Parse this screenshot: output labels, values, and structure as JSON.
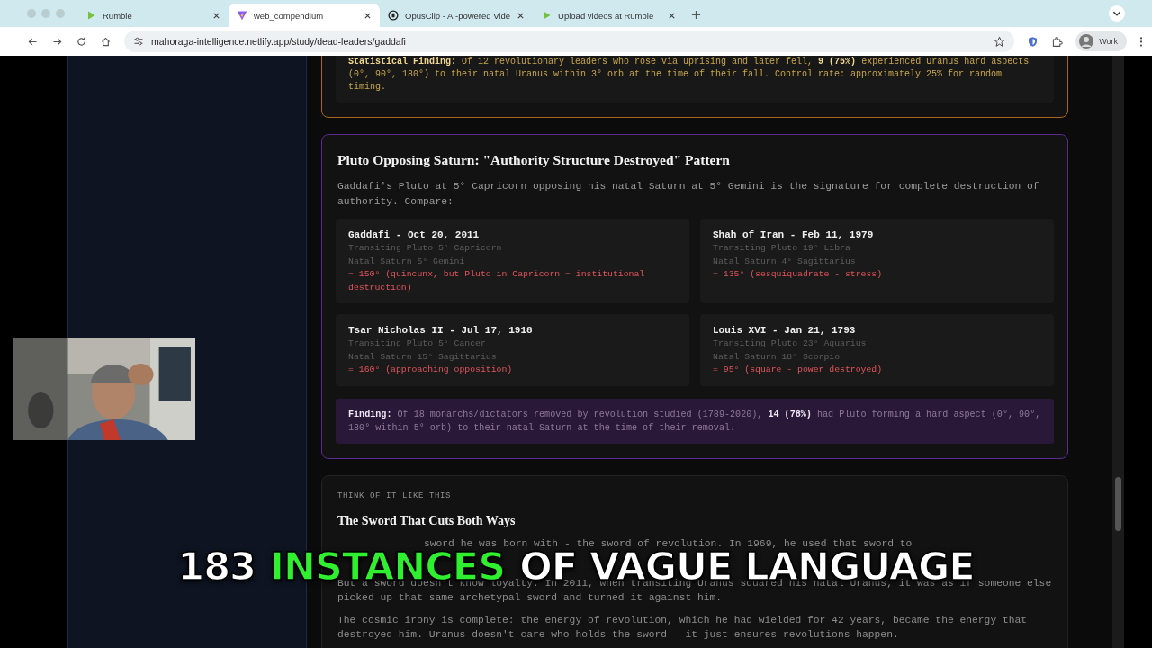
{
  "browser": {
    "tabs": [
      {
        "title": "Rumble",
        "selected": false
      },
      {
        "title": "web_compendium",
        "selected": true
      },
      {
        "title": "OpusClip - AI-powered Vide",
        "selected": false
      },
      {
        "title": "Upload videos at Rumble",
        "selected": false
      }
    ],
    "url": "mahoraga-intelligence.netlify.app/study/dead-leaders/gaddafi",
    "profile": "Work"
  },
  "uranus_card": {
    "finding": "**Statistical Finding:** Of 12 revolutionary leaders who rose via uprising and later fell, **9 (75%)** experienced Uranus hard aspects (0°, 90°, 180°) to their natal Uranus within 3° orb at the time of their fall. Control rate: approximately 25% for random timing."
  },
  "pluto_card": {
    "title": "Pluto Opposing Saturn: \"Authority Structure Destroyed\" Pattern",
    "intro": "Gaddafi's Pluto at 5° Capricorn opposing his natal Saturn at 5° Gemini is the signature for complete destruction of authority. Compare:",
    "comparisons": [
      {
        "name": "Gaddafi - Oct 20, 2011",
        "transit": "Transiting Pluto 5° Capricorn",
        "natal": "Natal Saturn 5° Gemini",
        "result": "= 150° (quincunx, but Pluto in Capricorn = institutional destruction)"
      },
      {
        "name": "Shah of Iran - Feb 11, 1979",
        "transit": "Transiting Pluto 19° Libra",
        "natal": "Natal Saturn 4° Sagittarius",
        "result": "= 135° (sesquiquadrate - stress)"
      },
      {
        "name": "Tsar Nicholas II - Jul 17, 1918",
        "transit": "Transiting Pluto 5° Cancer",
        "natal": "Natal Saturn 15° Sagittarius",
        "result": "= 160° (approaching opposition)"
      },
      {
        "name": "Louis XVI - Jan 21, 1793",
        "transit": "Transiting Pluto 23° Aquarius",
        "natal": "Natal Saturn 18° Scorpio",
        "result": "= 95° (square - power destroyed)"
      }
    ],
    "finding": "**Finding:** Of 18 monarchs/dictators removed by revolution studied (1789-2020), **14 (78%)** had Pluto forming a hard aspect (0°, 90°, 180° within 5° orb) to their natal Saturn at the time of their removal."
  },
  "sword_card": {
    "eyebrow": "THINK OF IT LIKE THIS",
    "title": "The Sword That Cuts Both Ways",
    "paragraphs": [
      "sword he was born with - the sword of revolution. In 1969, he used that sword to",
      "But a sword doesn't know loyalty. In 2011, when transiting Uranus squared his natal Uranus, it was as if someone else picked up that same archetypal sword and turned it against him.",
      "The cosmic irony is complete: the energy of revolution, which he had wielded for 42 years, became the energy that destroyed him. Uranus doesn't care who holds the sword - it just ensures revolutions happen."
    ]
  },
  "caption": [
    {
      "text": "183",
      "kind": "plain"
    },
    {
      "text": "INSTANCES",
      "kind": "highlight"
    },
    {
      "text": "OF VAGUE LANGUAGE",
      "kind": "plain"
    }
  ]
}
